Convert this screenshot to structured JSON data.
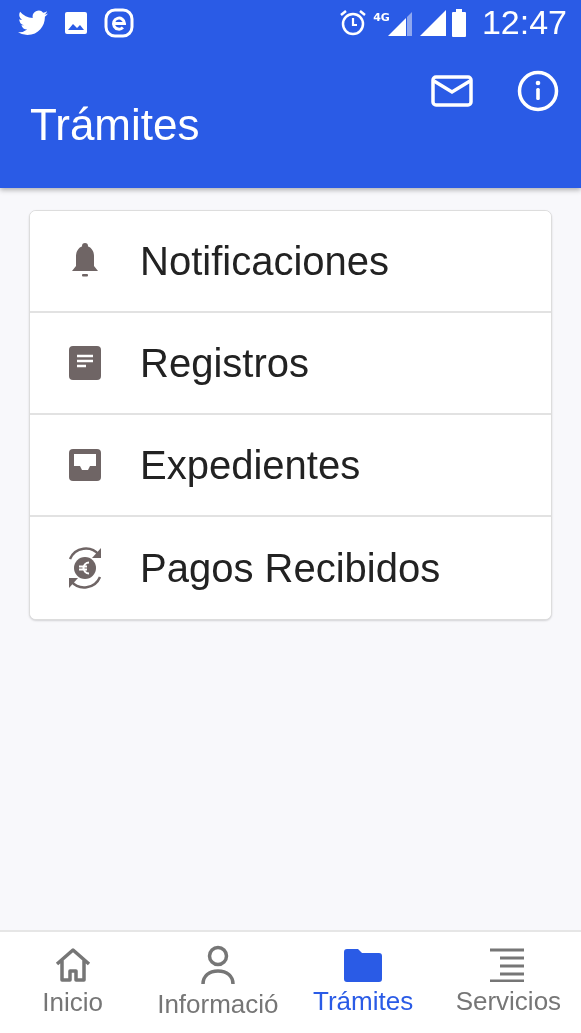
{
  "status_bar": {
    "time": "12:47",
    "network": "4G"
  },
  "app_bar": {
    "title": "Trámites"
  },
  "menu": [
    {
      "kind": "bell",
      "label": "Notificaciones"
    },
    {
      "kind": "document",
      "label": "Registros"
    },
    {
      "kind": "inbox",
      "label": "Expedientes"
    },
    {
      "kind": "payment",
      "label": "Pagos Recibidos"
    }
  ],
  "tabs": [
    {
      "kind": "home",
      "label": "Inicio",
      "selected": false
    },
    {
      "kind": "person",
      "label": "Informació",
      "selected": false
    },
    {
      "kind": "folder",
      "label": "Trámites",
      "selected": true
    },
    {
      "kind": "list",
      "label": "Servicios",
      "selected": false
    }
  ]
}
